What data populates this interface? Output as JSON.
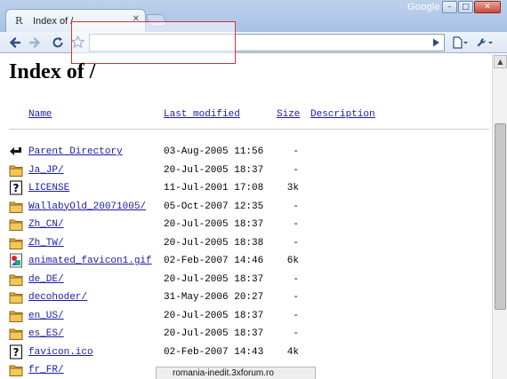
{
  "window": {
    "brand": "Google",
    "tab": {
      "favicon": "R",
      "title": "Index of /"
    }
  },
  "toolbar": {
    "address_value": ""
  },
  "page": {
    "title": "Index of /",
    "headers": {
      "name": "Name",
      "modified": "Last modified",
      "size": "Size",
      "description": "Description"
    }
  },
  "listing": [
    {
      "icon": "back-icon",
      "name": "Parent Directory",
      "modified": "03-Aug-2005 11:56",
      "size": "-"
    },
    {
      "icon": "folder-icon",
      "name": "Ja_JP/",
      "modified": "20-Jul-2005 18:37",
      "size": "-"
    },
    {
      "icon": "unknown-icon",
      "name": "LICENSE",
      "modified": "11-Jul-2001 17:08",
      "size": "3k"
    },
    {
      "icon": "folder-icon",
      "name": "WallabyOld_20071005/",
      "modified": "05-Oct-2007 12:35",
      "size": "-"
    },
    {
      "icon": "folder-icon",
      "name": "Zh_CN/",
      "modified": "20-Jul-2005 18:37",
      "size": "-"
    },
    {
      "icon": "folder-icon",
      "name": "Zh_TW/",
      "modified": "20-Jul-2005 18:38",
      "size": "-"
    },
    {
      "icon": "image-icon",
      "name": "animated_favicon1.gif",
      "modified": "02-Feb-2007 14:46",
      "size": "6k"
    },
    {
      "icon": "folder-icon",
      "name": "de_DE/",
      "modified": "20-Jul-2005 18:37",
      "size": "-"
    },
    {
      "icon": "folder-icon",
      "name": "decohoder/",
      "modified": "31-May-2006 20:27",
      "size": "-"
    },
    {
      "icon": "folder-icon",
      "name": "en_US/",
      "modified": "20-Jul-2005 18:37",
      "size": "-"
    },
    {
      "icon": "folder-icon",
      "name": "es_ES/",
      "modified": "20-Jul-2005 18:37",
      "size": "-"
    },
    {
      "icon": "unknown-icon",
      "name": "favicon.ico",
      "modified": "02-Feb-2007 14:43",
      "size": "4k"
    },
    {
      "icon": "folder-icon",
      "name": "fr_FR/",
      "modified": "",
      "size": ""
    }
  ],
  "status_bar": {
    "text": "romania-inedit.3xforum.ro"
  },
  "colors": {
    "link": "#1a1aa6",
    "chrome": "#bdd1ec"
  }
}
